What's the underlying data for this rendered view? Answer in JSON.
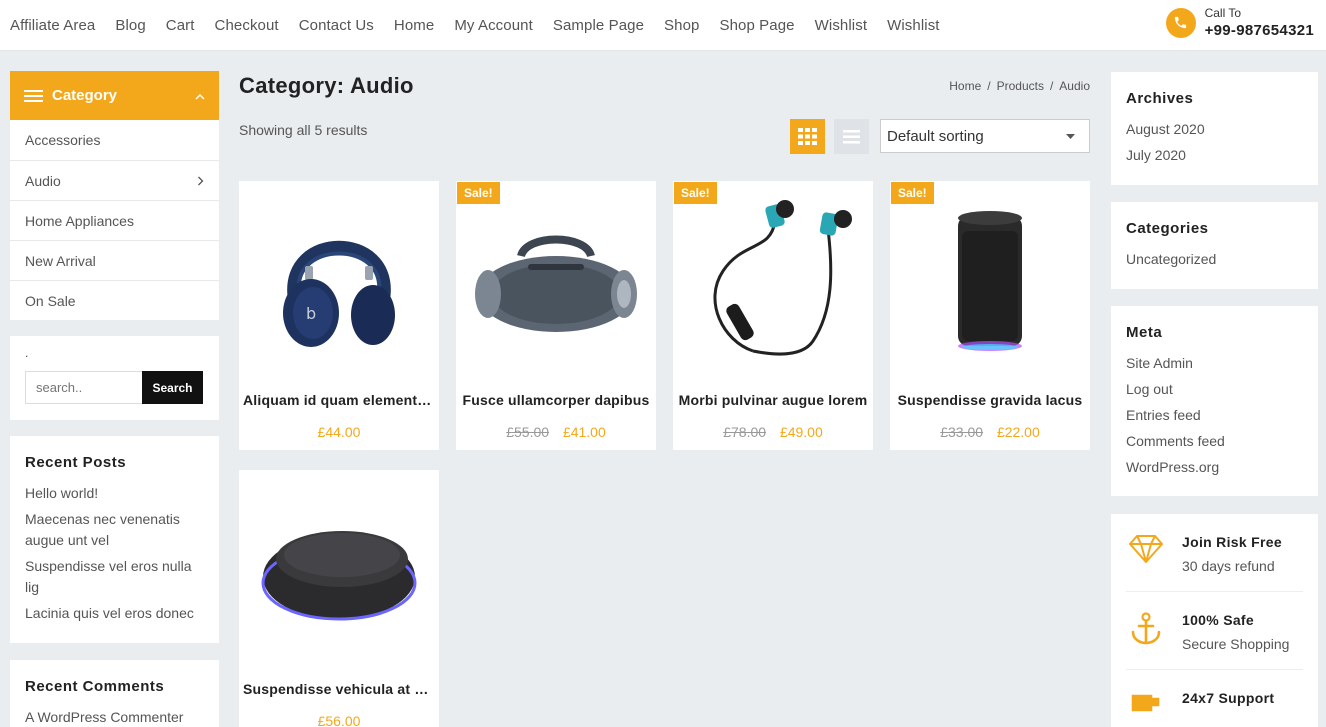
{
  "nav": {
    "links": [
      "Affiliate Area",
      "Blog",
      "Cart",
      "Checkout",
      "Contact Us",
      "Home",
      "My Account",
      "Sample Page",
      "Shop",
      "Shop Page",
      "Wishlist",
      "Wishlist"
    ]
  },
  "call": {
    "label": "Call To",
    "number": "+99-987654321",
    "icon": "phone-icon"
  },
  "category": {
    "title": "Category",
    "items": [
      "Accessories",
      "Audio",
      "Home Appliances",
      "New Arrival",
      "On Sale"
    ]
  },
  "search": {
    "dot": ".",
    "placeholder": "search..",
    "button": "Search"
  },
  "recent_posts": {
    "title": "Recent Posts",
    "items": [
      "Hello world!",
      "Maecenas nec venenatis augue unt vel",
      "Suspendisse vel eros nulla lig",
      "Lacinia quis vel eros donec"
    ]
  },
  "recent_comments": {
    "title": "Recent Comments",
    "items": [
      "A WordPress Commenter"
    ]
  },
  "main": {
    "title": "Category: Audio",
    "breadcrumb": [
      "Home",
      "/",
      "Products",
      "/",
      "Audio"
    ],
    "results": "Showing all 5 results",
    "sort": "Default sorting"
  },
  "products": [
    {
      "name": "Aliquam id quam elementum",
      "old_price": "",
      "price": "£44.00",
      "sale": ""
    },
    {
      "name": "Fusce ullamcorper dapibus",
      "old_price": "£55.00",
      "price": "£41.00",
      "sale": "Sale!"
    },
    {
      "name": "Morbi pulvinar augue lorem",
      "old_price": "£78.00",
      "price": "£49.00",
      "sale": "Sale!"
    },
    {
      "name": "Suspendisse gravida lacus",
      "old_price": "£33.00",
      "price": "£22.00",
      "sale": "Sale!"
    },
    {
      "name": "Suspendisse vehicula at dui",
      "old_price": "",
      "price": "£56.00",
      "sale": ""
    }
  ],
  "archives": {
    "title": "Archives",
    "items": [
      "August 2020",
      "July 2020"
    ]
  },
  "categories": {
    "title": "Categories",
    "items": [
      "Uncategorized"
    ]
  },
  "meta": {
    "title": "Meta",
    "items": [
      "Site Admin",
      "Log out",
      "Entries feed",
      "Comments feed",
      "WordPress.org"
    ]
  },
  "features": [
    {
      "icon": "diamond-icon",
      "title": "Join Risk Free",
      "sub": "30 days refund"
    },
    {
      "icon": "anchor-icon",
      "title": "100% Safe",
      "sub": "Secure Shopping"
    },
    {
      "icon": "support-icon",
      "title": "24x7 Support",
      "sub": ""
    }
  ],
  "colors": {
    "accent": "#f3a81b",
    "background": "#eaedf0",
    "dark": "#111111"
  }
}
